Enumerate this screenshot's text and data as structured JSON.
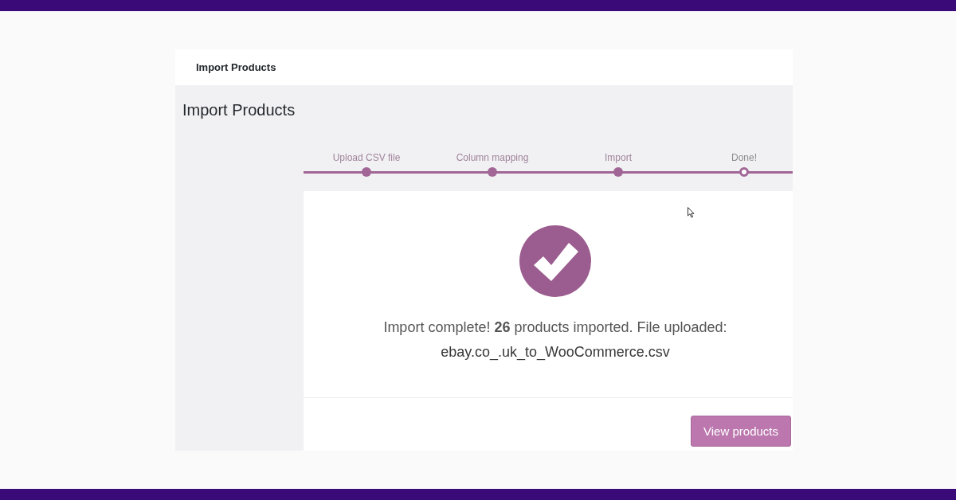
{
  "header": {
    "title": "Import Products"
  },
  "page_title": "Import Products",
  "steps": [
    {
      "label": "Upload CSV file",
      "selected": false
    },
    {
      "label": "Column mapping",
      "selected": false
    },
    {
      "label": "Import",
      "selected": false
    },
    {
      "label": "Done!",
      "selected": true
    }
  ],
  "result": {
    "message": "Import complete! **26** products imported. File uploaded:",
    "file_name": "ebay.co_.uk_to_WooCommerce.csv"
  },
  "buttons": [
    {
      "label": "View products"
    }
  ]
}
